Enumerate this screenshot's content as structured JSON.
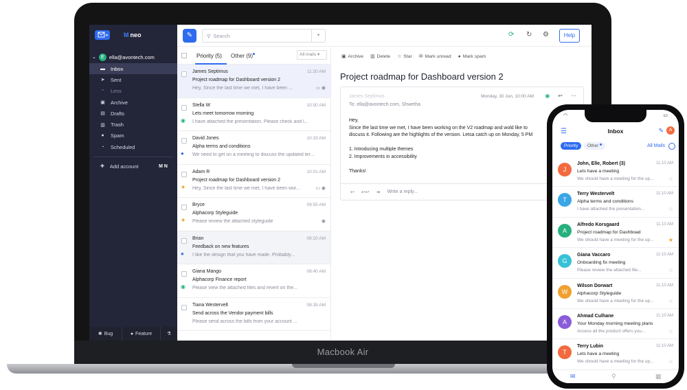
{
  "app": {
    "logo_text": "neo",
    "logo_mark": "M",
    "device_label": "Macbook Air"
  },
  "sidebar": {
    "account": "ella@avontech.com",
    "account_initial": "E",
    "items": [
      {
        "label": "Inbox",
        "icon": "inbox-icon",
        "glyph": "▬"
      },
      {
        "label": "Sent",
        "icon": "send-icon",
        "glyph": "➤"
      },
      {
        "label": "Less",
        "icon": "chevron-up-icon",
        "glyph": "⌃"
      },
      {
        "label": "Archive",
        "icon": "archive-icon",
        "glyph": "▣"
      },
      {
        "label": "Drafts",
        "icon": "drafts-icon",
        "glyph": "▤"
      },
      {
        "label": "Trash",
        "icon": "trash-icon",
        "glyph": "▥"
      },
      {
        "label": "Spam",
        "icon": "spam-icon",
        "glyph": "●"
      },
      {
        "label": "Scheduled",
        "icon": "clock-icon",
        "glyph": "◔"
      }
    ],
    "add_account": "Add account",
    "add_account_brands": "M N",
    "bottom": {
      "bug": "Bug",
      "feature": "Feature"
    }
  },
  "toolbar": {
    "search_placeholder": "Search",
    "help": "Help"
  },
  "list": {
    "tab_priority": "Priority (5)",
    "tab_other": "Other (9)",
    "filter": "All mails",
    "mails": [
      {
        "from": "James Septimus",
        "time": "11:20 AM",
        "subject": "Project roadmap for Dashboard version 2",
        "preview": "Hey, Since the last time we met, I have been ...",
        "tail": "▭ ◉",
        "flag": "",
        "flag_color": "",
        "state": "sel"
      },
      {
        "from": "Stella W",
        "time": "10:50 AM",
        "subject": "Lets meet tomorrow morning",
        "preview": "I have attached the presentation. Please check and l...",
        "tail": "",
        "flag": "◉",
        "flag_color": "#27b07e",
        "state": ""
      },
      {
        "from": "David Jones",
        "time": "10:33 AM",
        "subject": "Alpha terms and conditions",
        "preview": "We need to get on a meeting to discuss the updated ter...",
        "tail": "",
        "flag": "●",
        "flag_color": "#2f6bf0",
        "state": ""
      },
      {
        "from": "Adam R",
        "time": "10:01 AM",
        "subject": "Project roadmap for Dashboard version 2",
        "preview": "Hey, Since the last time we met, I have been wor...",
        "tail": "▭ ◉",
        "flag": "★",
        "flag_color": "#f0a030",
        "state": ""
      },
      {
        "from": "Bryce",
        "time": "09:55 AM",
        "subject": "Alphacorp Styleguide",
        "preview": "Please review the attached styleguide",
        "tail": "◉",
        "flag": "★",
        "flag_color": "#f0a030",
        "state": ""
      },
      {
        "from": "Brian",
        "time": "09:20 AM",
        "subject": "Feedback on new features",
        "preview": "I like the design that you have made. Probably...",
        "tail": "",
        "flag": "●",
        "flag_color": "#2f6bf0",
        "state": "greyed"
      },
      {
        "from": "Giana Mango",
        "time": "08:40 AM",
        "subject": "Alphacorp Finance report",
        "preview": "Please view the attached files and revert on the...",
        "tail": "",
        "flag": "◉",
        "flag_color": "#27b07e",
        "state": ""
      },
      {
        "from": "Tiana Westervelt",
        "time": "08:35 AM",
        "subject": "Send across the Vendor payment bills",
        "preview": "Please send across the bills from your account ...",
        "tail": "",
        "flag": "",
        "flag_color": "",
        "state": ""
      }
    ]
  },
  "reader": {
    "actions": [
      "Archive",
      "Delete",
      "Star",
      "Mark unread",
      "Mark spam"
    ],
    "title": "Project roadmap for Dashboard version 2",
    "from": "James Septimus",
    "to": "To: ella@avontech.com, Shwetha",
    "date": "Monday, 30 Jun, 10:00 AM",
    "body": [
      "Hey,",
      "Since the last time we met, I have been working on the V2 roadmap and wold like to",
      "discuss it. Following are the highlights of the version. Letsa catch up on Monday, 5 PM",
      "",
      "1. Introducing multiple themes",
      "2. Improvements in accessibility",
      "",
      "Thanks!"
    ],
    "reply_placeholder": "Write a reply..."
  },
  "phone": {
    "title": "Inbox",
    "avatar": "A",
    "tab_priority": "Priority",
    "tab_other": "Other",
    "all_mails": "All Mails",
    "mails": [
      {
        "initial": "J",
        "color": "#f26a3e",
        "from": "John, Elle, Robert (3)",
        "time": "11:10 AM",
        "subject": "Lets have a meeting",
        "preview": "We should have a meeting for the up...",
        "star": "☆",
        "star_color": "#b5b7c2"
      },
      {
        "initial": "T",
        "color": "#3aa6e8",
        "from": "Terry Westervelt",
        "time": "11:10 AM",
        "subject": "Alpha terms and conditions",
        "preview": "I have attached the presentation...",
        "star": "☆",
        "star_color": "#b5b7c2"
      },
      {
        "initial": "A",
        "color": "#27b07e",
        "from": "Alfredo Korsgaard",
        "time": "11:10 AM",
        "subject": "Project roadmap for Dashboad",
        "preview": "We should have a meeting for the up...",
        "star": "★",
        "star_color": "#f0a030"
      },
      {
        "initial": "G",
        "color": "#37c1d6",
        "from": "Giana Vaccaro",
        "time": "11:10 AM",
        "subject": "Onboarding fix meeting",
        "preview": "Please review the attached file...",
        "star": "☆",
        "star_color": "#b5b7c2"
      },
      {
        "initial": "W",
        "color": "#f0a030",
        "from": "Wilson Dorwart",
        "time": "11:10 AM",
        "subject": "Alphacorp Styleguide",
        "preview": "We should have a meeting for the up...",
        "star": "☆",
        "star_color": "#b5b7c2"
      },
      {
        "initial": "A",
        "color": "#8a5cd9",
        "from": "Ahmad Culhane",
        "time": "11:10 AM",
        "subject": "Your Monday morning meeting plans",
        "preview": "Access all the product offers you...",
        "star": "☆",
        "star_color": "#b5b7c2"
      },
      {
        "initial": "T",
        "color": "#f26a3e",
        "from": "Terry Lubin",
        "time": "11:10 AM",
        "subject": "Lets have a meeting",
        "preview": "We should have a meeting for the up...",
        "star": "☆",
        "star_color": "#b5b7c2"
      }
    ]
  }
}
